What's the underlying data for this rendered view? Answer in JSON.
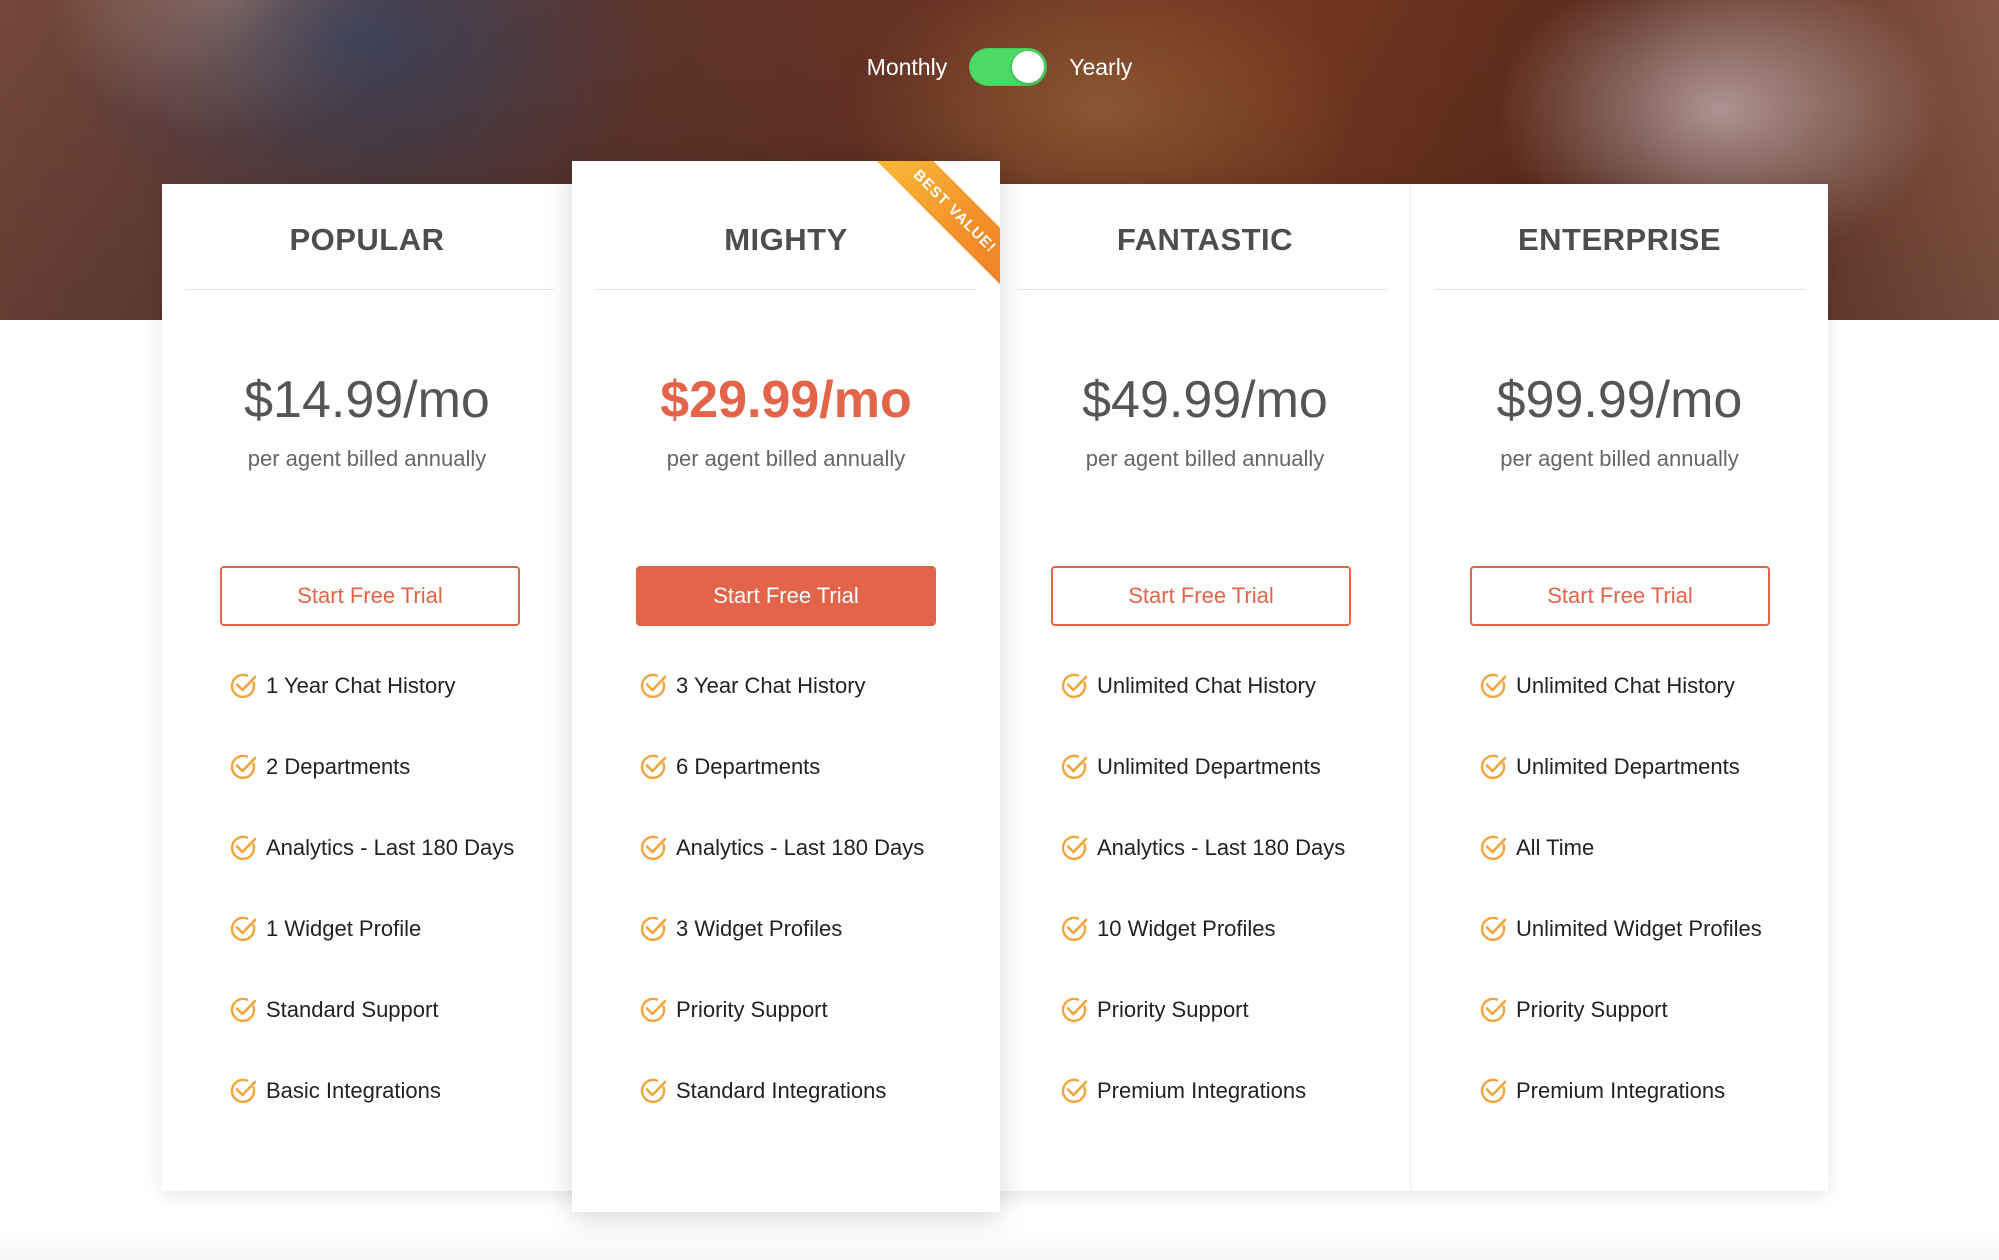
{
  "billing_toggle": {
    "monthly_label": "Monthly",
    "yearly_label": "Yearly",
    "selected": "Yearly",
    "on_color": "#4cd964"
  },
  "accent_color": "#e4644a",
  "check_color": "#f3a43b",
  "plans": [
    {
      "name": "POPULAR",
      "price": "$14.99/mo",
      "billing_note": "per agent billed annually",
      "cta_label": "Start Free Trial",
      "features": [
        "1 Year Chat History",
        "2 Departments",
        "Analytics - Last 180 Days",
        "1 Widget Profile",
        "Standard Support",
        "Basic Integrations"
      ]
    },
    {
      "name": "MIGHTY",
      "ribbon_label": "BEST VALUE!",
      "price": "$29.99/mo",
      "billing_note": "per agent billed annually",
      "cta_label": "Start Free Trial",
      "features": [
        "3 Year Chat History",
        "6 Departments",
        "Analytics - Last 180 Days",
        "3 Widget Profiles",
        "Priority Support",
        "Standard Integrations"
      ]
    },
    {
      "name": "FANTASTIC",
      "price": "$49.99/mo",
      "billing_note": "per agent billed annually",
      "cta_label": "Start Free Trial",
      "features": [
        "Unlimited Chat History",
        "Unlimited Departments",
        "Analytics - Last 180 Days",
        "10 Widget Profiles",
        "Priority Support",
        "Premium Integrations"
      ]
    },
    {
      "name": "ENTERPRISE",
      "price": "$99.99/mo",
      "billing_note": "per agent billed annually",
      "cta_label": "Start Free Trial",
      "features": [
        "Unlimited Chat History",
        "Unlimited Departments",
        "All Time",
        "Unlimited Widget Profiles",
        "Priority Support",
        "Premium Integrations"
      ]
    }
  ]
}
